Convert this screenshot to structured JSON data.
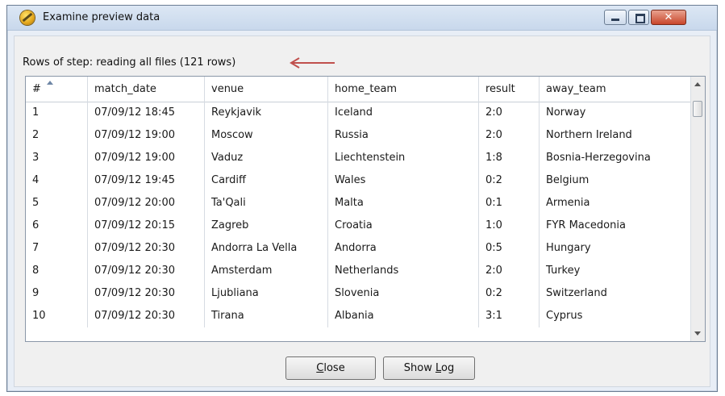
{
  "window": {
    "title": "Examine preview data",
    "icon": "kettle-icon"
  },
  "rows_label": "Rows of step: reading all files (121 rows)",
  "annotation_arrow_color": "#c0504d",
  "table": {
    "columns": [
      "#",
      "match_date",
      "venue",
      "home_team",
      "result",
      "away_team"
    ],
    "rows": [
      [
        "1",
        "07/09/12 18:45",
        "Reykjavik",
        "Iceland",
        "2:0",
        "Norway"
      ],
      [
        "2",
        "07/09/12 19:00",
        "Moscow",
        "Russia",
        "2:0",
        "Northern Ireland"
      ],
      [
        "3",
        "07/09/12 19:00",
        "Vaduz",
        "Liechtenstein",
        "1:8",
        "Bosnia-Herzegovina"
      ],
      [
        "4",
        "07/09/12 19:45",
        "Cardiff",
        "Wales",
        "0:2",
        "Belgium"
      ],
      [
        "5",
        "07/09/12 20:00",
        "Ta'Qali",
        "Malta",
        "0:1",
        "Armenia"
      ],
      [
        "6",
        "07/09/12 20:15",
        "Zagreb",
        "Croatia",
        "1:0",
        "FYR Macedonia"
      ],
      [
        "7",
        "07/09/12 20:30",
        "Andorra La Vella",
        "Andorra",
        "0:5",
        "Hungary"
      ],
      [
        "8",
        "07/09/12 20:30",
        "Amsterdam",
        "Netherlands",
        "2:0",
        "Turkey"
      ],
      [
        "9",
        "07/09/12 20:30",
        "Ljubliana",
        "Slovenia",
        "0:2",
        "Switzerland"
      ],
      [
        "10",
        "07/09/12 20:30",
        "Tirana",
        "Albania",
        "3:1",
        "Cyprus"
      ]
    ]
  },
  "buttons": {
    "close": {
      "mnemonic": "C",
      "rest": "lose"
    },
    "show_log": {
      "before": "Show ",
      "mnemonic": "L",
      "rest": "og"
    }
  }
}
